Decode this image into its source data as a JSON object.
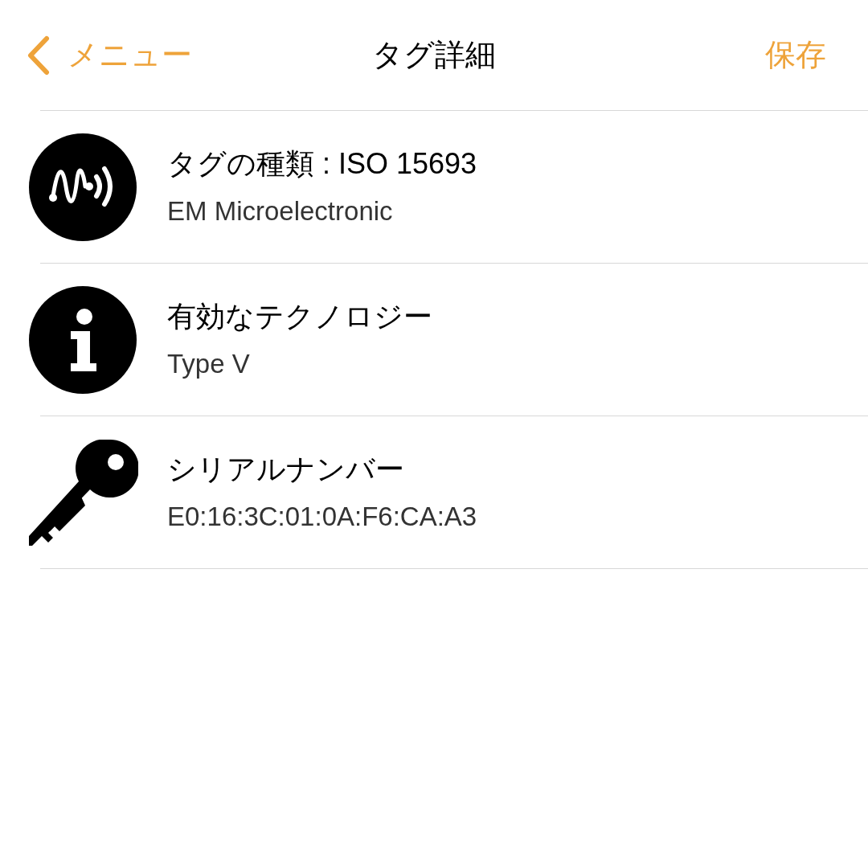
{
  "nav": {
    "back": "メニュー",
    "title": "タグ詳細",
    "action": "保存"
  },
  "rows": [
    {
      "kind": "wave",
      "title": "タグの種類 : ISO 15693",
      "subtitle": "EM Microelectronic"
    },
    {
      "kind": "info",
      "title": "有効なテクノロジー",
      "subtitle": "Type V"
    },
    {
      "kind": "key",
      "title": "シリアルナンバー",
      "subtitle": "E0:16:3C:01:0A:F6:CA:A3"
    }
  ]
}
